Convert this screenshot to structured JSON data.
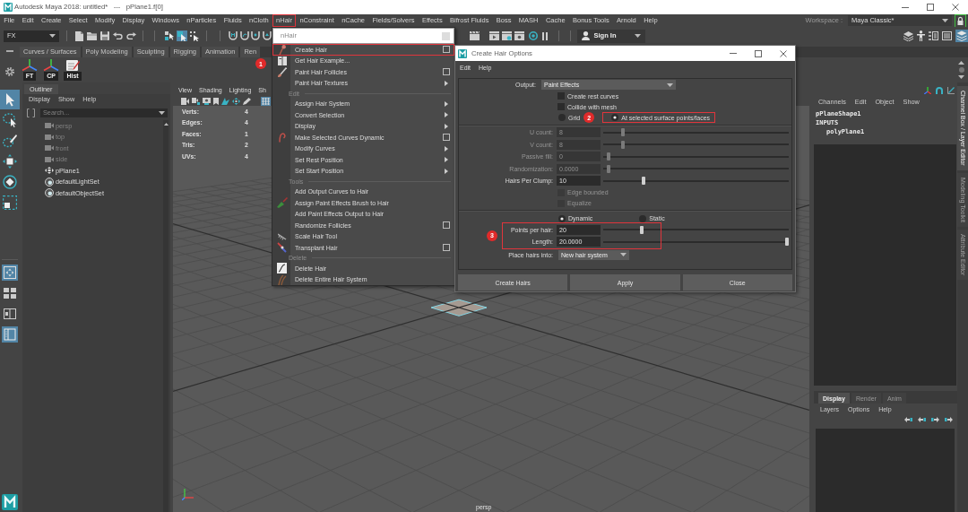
{
  "window": {
    "title": "Autodesk Maya 2018: untitled*   ---   pPlane1.f[0]"
  },
  "menu_bar": {
    "items": [
      {
        "label": "File",
        "outlined": false
      },
      {
        "label": "Edit",
        "outlined": false
      },
      {
        "label": "Create",
        "outlined": false
      },
      {
        "label": "Select",
        "outlined": false
      },
      {
        "label": "Modify",
        "outlined": false
      },
      {
        "label": "Display",
        "outlined": false
      },
      {
        "label": "Windows",
        "outlined": false
      },
      {
        "label": "nParticles",
        "outlined": false
      },
      {
        "label": "Fluids",
        "outlined": false
      },
      {
        "label": "nCloth",
        "outlined": false
      },
      {
        "label": "nHair",
        "outlined": true
      },
      {
        "label": "nConstraint",
        "outlined": false
      },
      {
        "label": "nCache",
        "outlined": false
      },
      {
        "label": "Fields/Solvers",
        "outlined": false
      },
      {
        "label": "Effects",
        "outlined": false
      },
      {
        "label": "Bifrost Fluids",
        "outlined": false
      },
      {
        "label": "Boss",
        "outlined": false
      },
      {
        "label": "MASH",
        "outlined": false
      },
      {
        "label": "Cache",
        "outlined": false
      },
      {
        "label": "Bonus Tools",
        "outlined": false
      },
      {
        "label": "Arnold",
        "outlined": false
      },
      {
        "label": "Help",
        "outlined": false
      }
    ],
    "workspace_label": "Workspace :",
    "workspace": "Maya Classic*"
  },
  "status_line": {
    "menu_set": "FX",
    "selection_modes": [
      {
        "selected": false
      },
      {
        "selected": true
      },
      {
        "selected": false
      }
    ],
    "sign_in": "Sign In",
    "panel_toggles": [
      {
        "selected": false
      },
      {
        "selected": false
      },
      {
        "selected": false
      },
      {
        "selected": false
      },
      {
        "selected": true
      }
    ]
  },
  "shelf": {
    "tabs": [
      "Curves / Surfaces",
      "Poly Modeling",
      "Sculpting",
      "Rigging",
      "Animation",
      "Ren"
    ],
    "tools": [
      "FT",
      "CP",
      "Hist"
    ]
  },
  "toolbox": {
    "tools": [
      {
        "selected": true
      },
      {
        "selected": false
      },
      {
        "selected": false
      },
      {
        "selected": false
      },
      {
        "selected": false
      },
      {
        "selected": false
      }
    ],
    "layouts": [
      {
        "selected": true
      },
      {
        "selected": false
      },
      {
        "selected": false
      },
      {
        "selected": true
      }
    ]
  },
  "outliner": {
    "title": "Outliner",
    "menu": [
      "Display",
      "Show",
      "Help"
    ],
    "search": {
      "placeholder": "Search..."
    },
    "items": [
      {
        "label": "persp",
        "kind": "camera",
        "hidden": true
      },
      {
        "label": "top",
        "kind": "camera",
        "hidden": true
      },
      {
        "label": "front",
        "kind": "camera",
        "hidden": true
      },
      {
        "label": "side",
        "kind": "camera",
        "hidden": true
      },
      {
        "label": "pPlane1",
        "kind": "transform",
        "hidden": false
      },
      {
        "label": "defaultLightSet",
        "kind": "set",
        "hidden": false
      },
      {
        "label": "defaultObjectSet",
        "kind": "set",
        "hidden": false
      }
    ]
  },
  "viewport": {
    "menu": [
      "View",
      "Shading",
      "Lighting",
      "Sh"
    ],
    "toolbar": [
      {
        "selected": false
      },
      {
        "selected": false
      },
      {
        "selected": false
      },
      {
        "selected": false
      },
      {
        "selected": false
      },
      {
        "selected": false
      },
      {
        "selected": false
      },
      {
        "selected": true
      }
    ],
    "stats": [
      {
        "label": "Verts:",
        "value": "4"
      },
      {
        "label": "Edges:",
        "value": "4"
      },
      {
        "label": "Faces:",
        "value": "1"
      },
      {
        "label": "Tris:",
        "value": "2"
      },
      {
        "label": "UVs:",
        "value": "4"
      }
    ],
    "camera": "persp"
  },
  "channel_box": {
    "menu": [
      "Channels",
      "Edit",
      "Object",
      "Show"
    ],
    "shape": "pPlaneShape1",
    "section": "INPUTS",
    "inputs": [
      "polyPlane1"
    ]
  },
  "layer_editor": {
    "tabs": [
      {
        "label": "Display",
        "selected": true
      },
      {
        "label": "Render",
        "selected": false
      },
      {
        "label": "Anim",
        "selected": false
      }
    ],
    "menu": [
      "Layers",
      "Options",
      "Help"
    ]
  },
  "side_tabs": [
    {
      "label": "Channel Box / Layer Editor",
      "selected": true
    },
    {
      "label": "Modeling Toolkit",
      "selected": false
    },
    {
      "label": "Attribute Editor",
      "selected": false
    }
  ],
  "nhair_menu": {
    "header": "nHair",
    "callout": "1",
    "items": [
      {
        "kind": "option",
        "label": "Create Hair",
        "outlined": true
      },
      {
        "kind": "command",
        "label": "Get Hair Example...",
        "outlined": false
      },
      {
        "kind": "option",
        "label": "Paint Hair Follicles",
        "outlined": false
      },
      {
        "kind": "submenu",
        "label": "Paint Hair Textures",
        "outlined": false
      },
      {
        "kind": "header",
        "label": "Edit",
        "outlined": false
      },
      {
        "kind": "submenu",
        "label": "Assign Hair System",
        "outlined": false
      },
      {
        "kind": "submenu",
        "label": "Convert Selection",
        "outlined": false
      },
      {
        "kind": "submenu",
        "label": "Display",
        "outlined": false
      },
      {
        "kind": "option",
        "label": "Make Selected Curves Dynamic",
        "outlined": false
      },
      {
        "kind": "submenu",
        "label": "Modify Curves",
        "outlined": false
      },
      {
        "kind": "submenu",
        "label": "Set Rest Position",
        "outlined": false
      },
      {
        "kind": "submenu",
        "label": "Set Start Position",
        "outlined": false
      },
      {
        "kind": "header",
        "label": "Tools",
        "outlined": false
      },
      {
        "kind": "command",
        "label": "Add Output Curves to Hair",
        "outlined": false
      },
      {
        "kind": "command",
        "label": "Assign Paint Effects Brush to Hair",
        "outlined": false
      },
      {
        "kind": "command",
        "label": "Add Paint Effects Output to Hair",
        "outlined": false
      },
      {
        "kind": "option",
        "label": "Randomize Follicles",
        "outlined": false
      },
      {
        "kind": "command",
        "label": "Scale Hair Tool",
        "outlined": false
      },
      {
        "kind": "option",
        "label": "Transplant Hair",
        "outlined": false
      },
      {
        "kind": "header",
        "label": "Delete",
        "outlined": false
      },
      {
        "kind": "command",
        "label": "Delete Hair",
        "outlined": false
      },
      {
        "kind": "command",
        "label": "Delete Entire Hair System",
        "outlined": false
      }
    ]
  },
  "dialog": {
    "title": "Create Hair Options",
    "menu": [
      "Edit",
      "Help"
    ],
    "output": {
      "label": "Output:",
      "value": "Paint Effects"
    },
    "checkboxes": [
      {
        "label": "Create rest curves",
        "checked": false
      },
      {
        "label": "Collide with mesh",
        "checked": false
      }
    ],
    "placement": {
      "callout": "2",
      "options": [
        {
          "label": "Grid",
          "selected": false,
          "outlined": false
        },
        {
          "label": "At selected surface points/faces",
          "selected": true,
          "outlined": true
        }
      ]
    },
    "grid_fields": [
      {
        "label": "U count:",
        "value": "8",
        "level": 0.1,
        "disabled": true
      },
      {
        "label": "V count:",
        "value": "8",
        "level": 0.1,
        "disabled": true
      },
      {
        "label": "Passive fill:",
        "value": "0",
        "level": 0.02,
        "disabled": true
      },
      {
        "label": "Randomization:",
        "value": "0.0000",
        "level": 0.02,
        "disabled": true
      },
      {
        "label": "Hairs Per Clump:",
        "value": "10",
        "level": 0.21,
        "disabled": false
      }
    ],
    "clump_options": [
      {
        "label": "Edge bounded",
        "checked": false,
        "disabled": true
      },
      {
        "label": "Equalize",
        "checked": false,
        "disabled": true
      }
    ],
    "simulation": [
      {
        "label": "Dynamic",
        "selected": true
      },
      {
        "label": "Static",
        "selected": false
      }
    ],
    "hair": {
      "callout": "3",
      "outlined": true,
      "fields": [
        {
          "label": "Points per hair:",
          "value": "20",
          "level": 0.2
        },
        {
          "label": "Length:",
          "value": "20.0000",
          "level": 1
        }
      ]
    },
    "place_into": {
      "label": "Place hairs into:",
      "value": "New hair system"
    },
    "buttons": [
      "Create Hairs",
      "Apply",
      "Close"
    ]
  }
}
